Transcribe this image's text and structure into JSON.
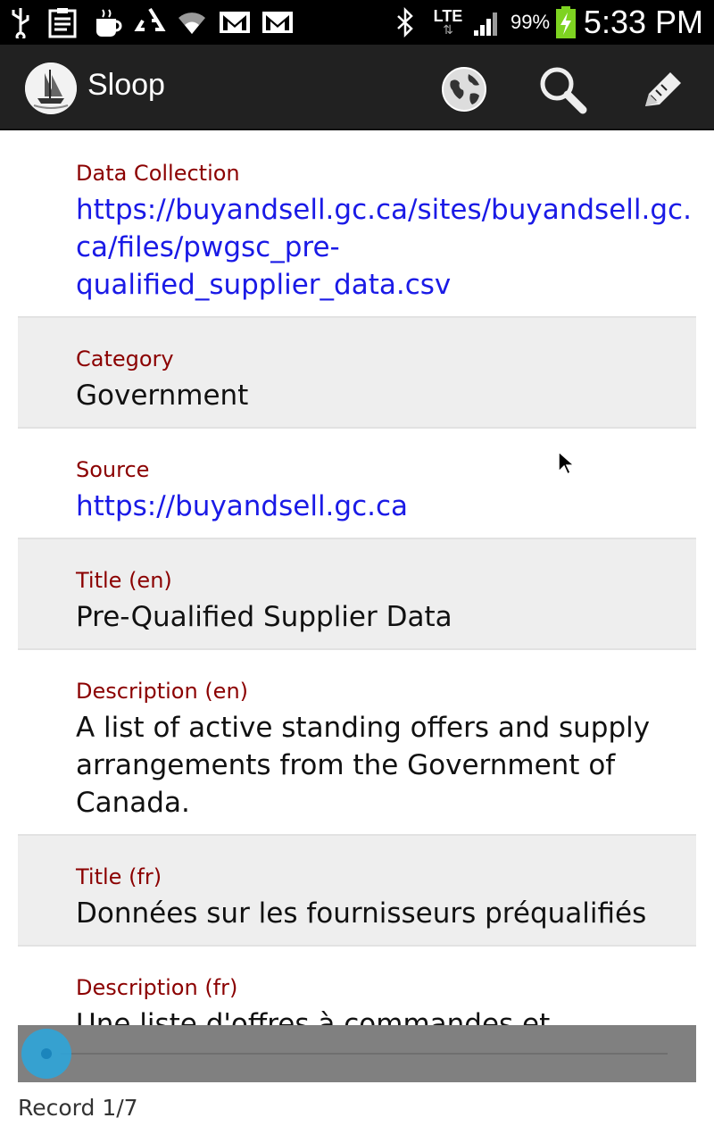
{
  "status_bar": {
    "battery_percent": "99%",
    "time": "5:33 PM",
    "network_type": "LTE",
    "icons": [
      "usb-icon",
      "clipboard-icon",
      "coffee-icon",
      "recycle-icon",
      "wifi-icon",
      "gmail-icon",
      "gmail-icon",
      "bluetooth-icon",
      "signal-icon",
      "battery-charging-icon"
    ]
  },
  "action_bar": {
    "title": "Sloop",
    "actions": [
      "globe-icon",
      "search-icon",
      "edit-icon"
    ]
  },
  "fields": [
    {
      "label": "Data Collection",
      "value": "https://buyandsell.gc.ca/sites/buyandsell.gc.ca/files/pwgsc_pre-qualified_supplier_data.csv",
      "link": true
    },
    {
      "label": "Category",
      "value": "Government",
      "link": false
    },
    {
      "label": "Source",
      "value": "https://buyandsell.gc.ca",
      "link": true
    },
    {
      "label": "Title (en)",
      "value": "Pre-Qualified Supplier Data",
      "link": false
    },
    {
      "label": "Description (en)",
      "value": "A list of active standing offers and supply arrangements from the Government of Canada.",
      "link": false
    },
    {
      "label": "Title (fr)",
      "value": "Données sur les fournisseurs préqualifiés",
      "link": false
    },
    {
      "label": "Description (fr)",
      "value": "Une liste d'offres à commandes et d'arrangements en matière d'approvisionnement actifs du",
      "link": false
    }
  ],
  "slider": {
    "position_fraction": 0
  },
  "footer": {
    "record_label": "Record 1/7"
  },
  "colors": {
    "label": "#8b0000",
    "link": "#1a1ae6",
    "action_bar": "#212121",
    "slider_thumb": "#2aa7df"
  }
}
